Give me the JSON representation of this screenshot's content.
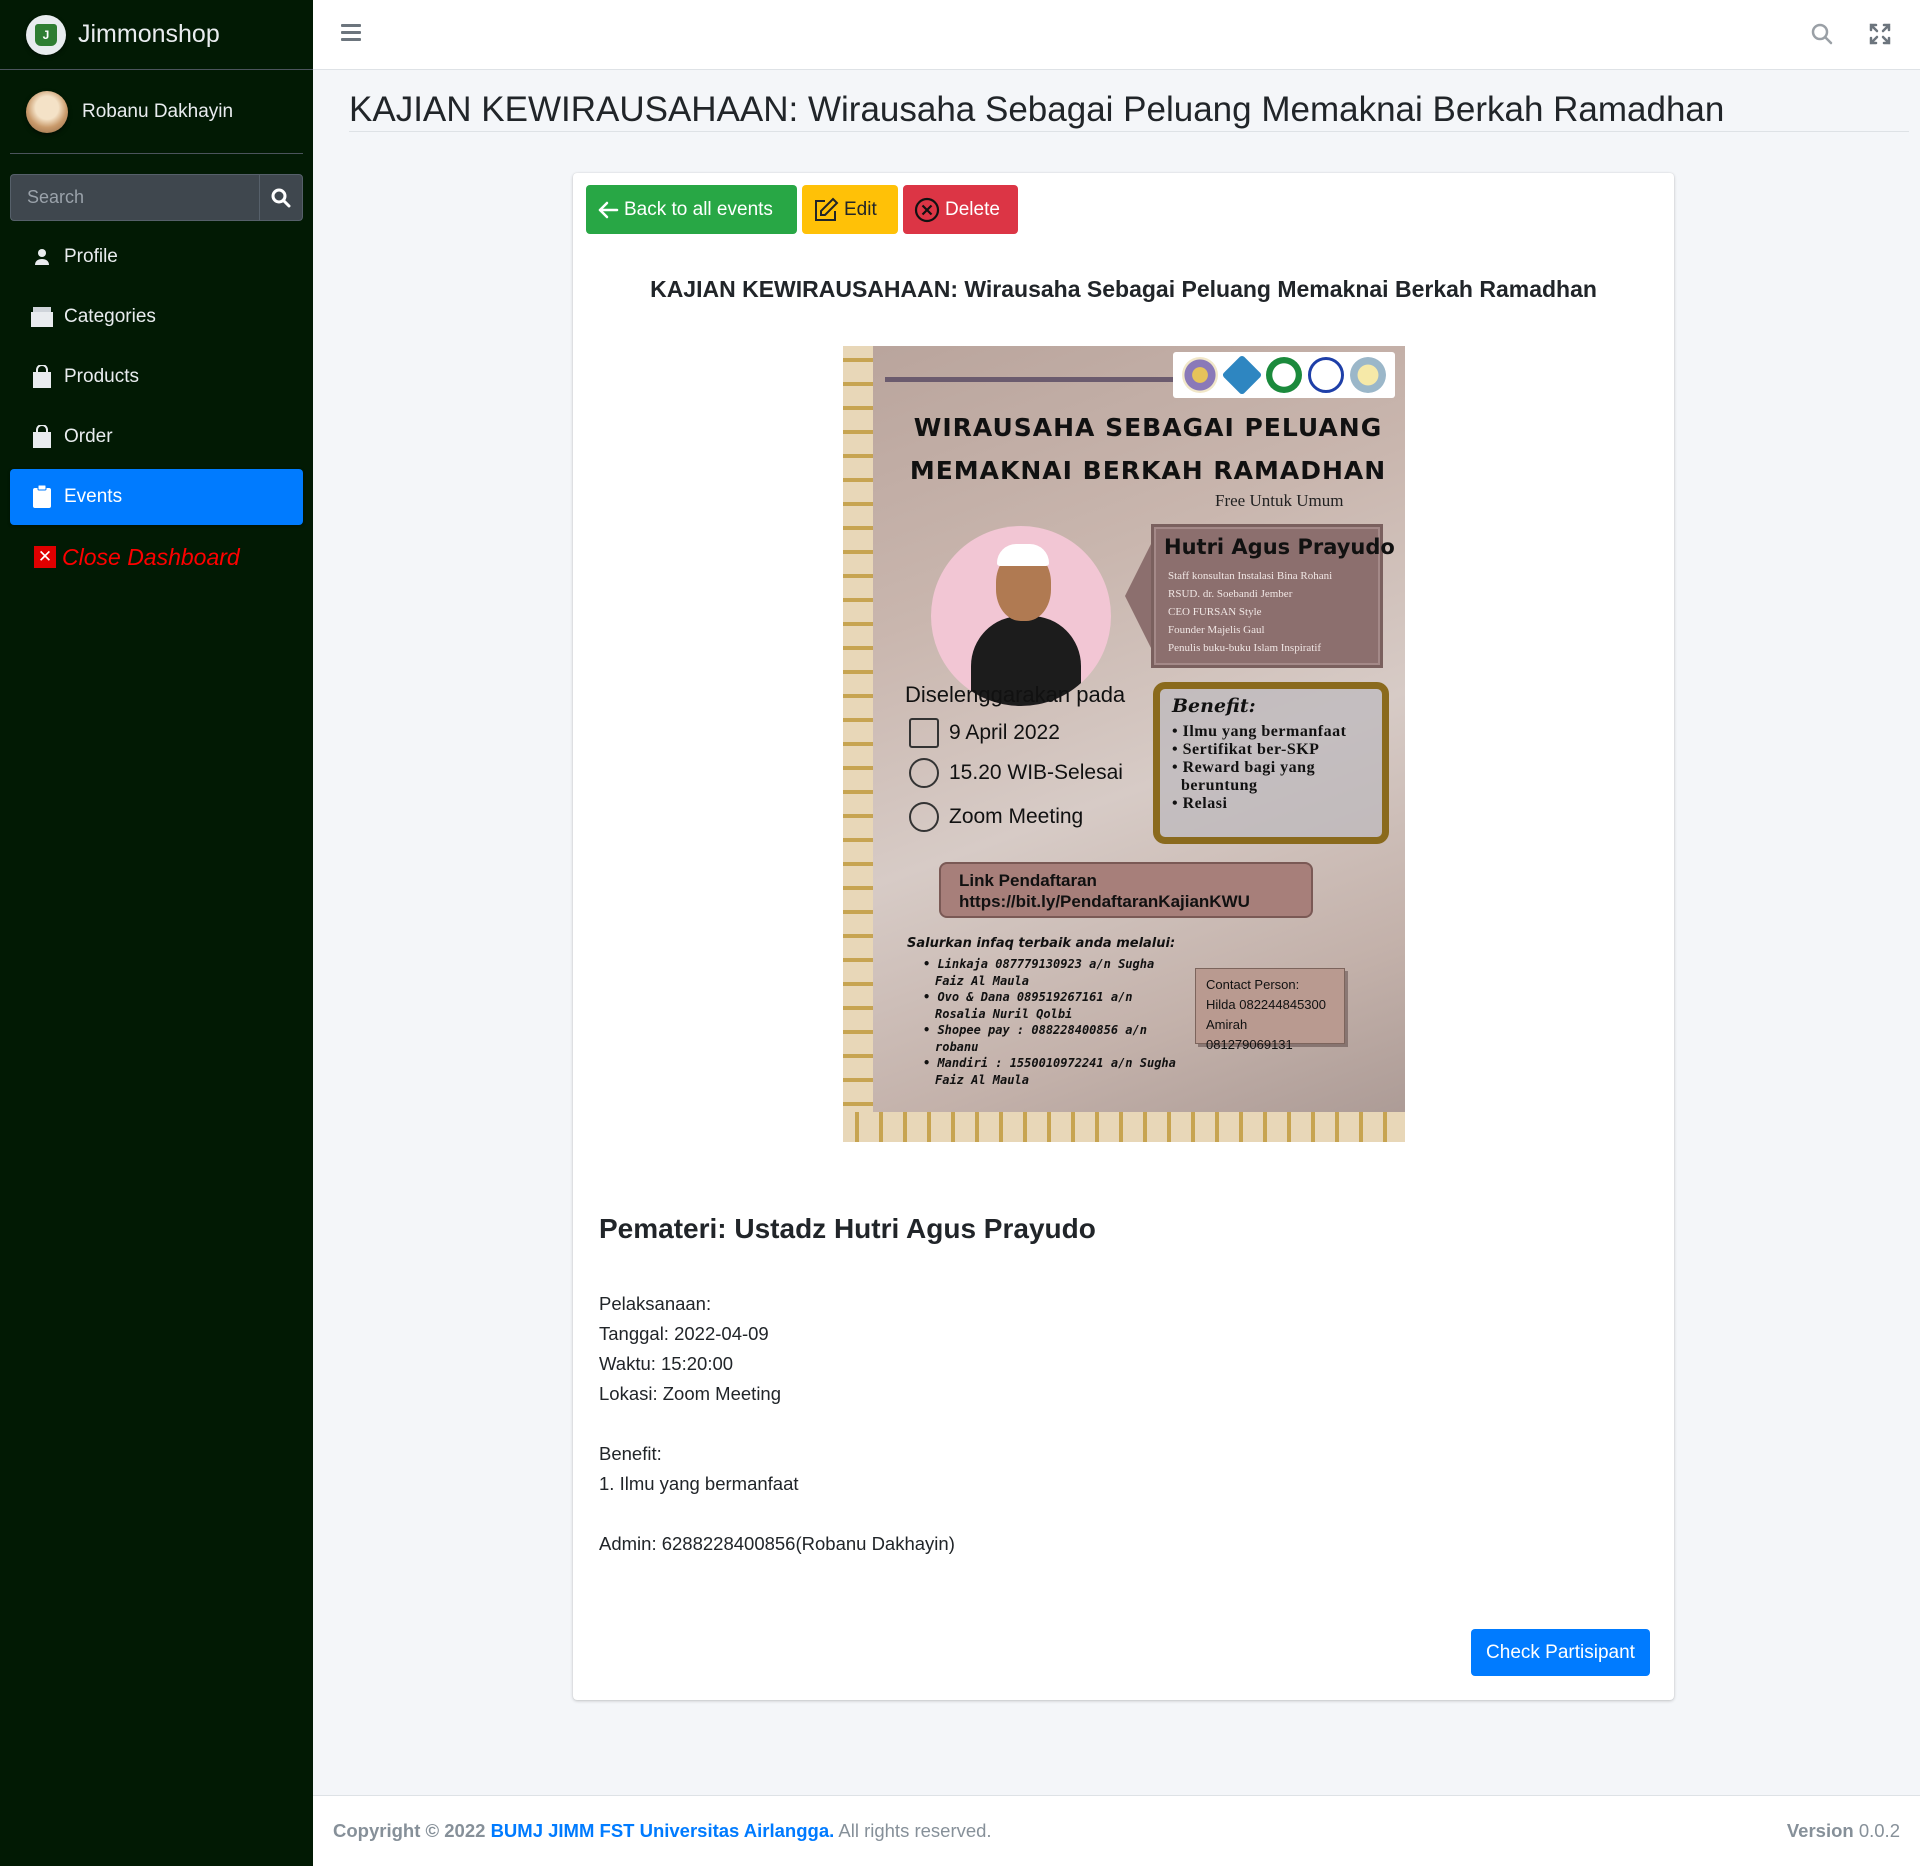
{
  "brand": {
    "name": "Jimmonshop",
    "logo_text": "J"
  },
  "user": {
    "name": "Robanu Dakhayin"
  },
  "sidebar": {
    "search_placeholder": "Search",
    "items": [
      {
        "label": "Profile",
        "icon": "user-icon"
      },
      {
        "label": "Categories",
        "icon": "folder-icon"
      },
      {
        "label": "Products",
        "icon": "shopping-bag-icon"
      },
      {
        "label": "Order",
        "icon": "shopping-bag-icon"
      },
      {
        "label": "Events",
        "icon": "clipboard-icon",
        "active": true
      },
      {
        "label": "Close Dashboard",
        "icon": "close-icon"
      }
    ]
  },
  "page": {
    "title": "KAJIAN KEWIRAUSAHAAN: Wirausaha Sebagai Peluang Memaknai Berkah Ramadhan"
  },
  "actions": {
    "back": "Back to all events",
    "edit": "Edit",
    "delete": "Delete"
  },
  "event": {
    "heading": "KAJIAN KEWIRAUSAHAAN: Wirausaha Sebagai Peluang Memaknai Berkah Ramadhan",
    "pemateri": "Pemateri: Ustadz Hutri Agus Prayudo",
    "pelaksanaan": "Pelaksanaan:",
    "tanggal": "Tanggal: 2022-04-09",
    "waktu": "Waktu: 15:20:00",
    "lokasi": "Lokasi: Zoom Meeting",
    "benefit_label": "Benefit:",
    "benefit_1": "1. Ilmu yang bermanfaat",
    "admin": "Admin: 6288228400856(Robanu Dakhayin)",
    "check_button": "Check Partisipant"
  },
  "poster": {
    "title_line1": "WIRAUSAHA SEBAGAI PELUANG",
    "title_line2": "MEMAKNAI BERKAH RAMADHAN",
    "free": "Free Untuk Umum",
    "speaker_name": "Hutri Agus Prayudo",
    "speaker_points": [
      "Staff konsultan Instalasi Bina Rohani",
      "RSUD. dr. Soebandi Jember",
      "CEO FURSAN Style",
      "Founder Majelis Gaul",
      "Penulis buku-buku Islam Inspiratif"
    ],
    "held_title": "Diselenggarakan pada",
    "date": "9 April 2022",
    "time": "15.20 WIB-Selesai",
    "place": "Zoom Meeting",
    "benefit_title": "Benefit:",
    "benefits": [
      "Ilmu yang bermanfaat",
      "Sertifikat ber-SKP",
      "Reward bagi yang",
      "beruntung",
      "Relasi"
    ],
    "link_label": "Link Pendaftaran",
    "link_url": "https://bit.ly/PendaftaranKajianKWU",
    "infaq_title": "Salurkan infaq terbaik anda melalui:",
    "infaq_lines": [
      "• Linkaja 087779130923 a/n Sugha",
      "  Faiz Al Maula",
      "• Ovo & Dana 089519267161 a/n",
      "  Rosalia Nuril Qolbi",
      "• Shopee pay : 088228400856 a/n",
      "  robanu",
      "• Mandiri : 1550010972241 a/n Sugha",
      "  Faiz Al Maula"
    ],
    "cp_title": "Contact Person:",
    "cp_1": "Hilda 082244845300",
    "cp_2": "Amirah 081279069131"
  },
  "footer": {
    "copyright": "Copyright © 2022",
    "org": "BUMJ JIMM FST Universitas Airlangga.",
    "rights": "All rights reserved.",
    "version_label": "Version",
    "version": "0.0.2"
  },
  "colors": {
    "sidebar_bg": "#021a04",
    "primary": "#007bff",
    "success": "#28a745",
    "warning": "#ffc107",
    "danger": "#dc3545"
  }
}
